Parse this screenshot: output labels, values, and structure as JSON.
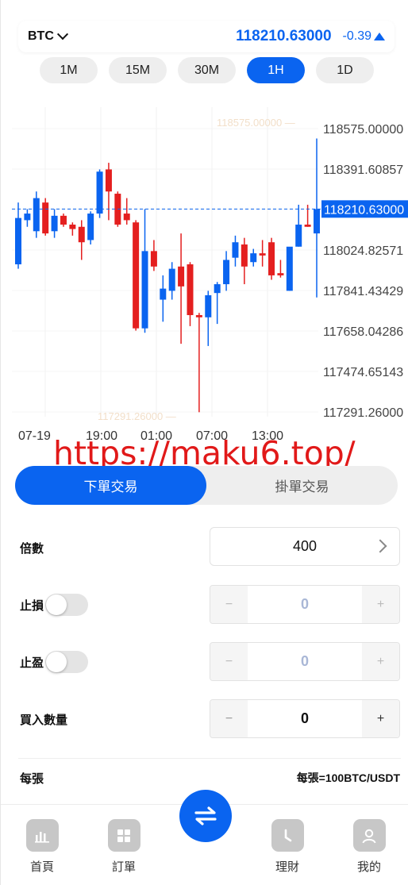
{
  "header": {
    "symbol": "BTC",
    "last_price": "118210.63000",
    "change": "-0.39"
  },
  "intervals": [
    {
      "label": "1M",
      "active": false
    },
    {
      "label": "15M",
      "active": false
    },
    {
      "label": "30M",
      "active": false
    },
    {
      "label": "1H",
      "active": true
    },
    {
      "label": "1D",
      "active": false
    }
  ],
  "colors": {
    "accent": "#0a64f0",
    "up": "#0a64f0",
    "down": "#e41f1f",
    "watermark": "#e11919"
  },
  "chart_data": {
    "type": "candlestick",
    "y_ticks": [
      "118575.00000",
      "118391.60857",
      "118210.63000",
      "118024.82571",
      "117841.43429",
      "117658.04286",
      "117474.65143",
      "117291.26000"
    ],
    "ylim": [
      117291.26,
      118575.0
    ],
    "x_ticks": [
      "07-19",
      "19:00",
      "01:00",
      "07:00",
      "13:00"
    ],
    "current_price_label": "118210.63000",
    "current_price": 118210.63,
    "max_label": "118575.00000",
    "min_label": "117291.26000",
    "candles": [
      {
        "o": 117960,
        "h": 118240,
        "l": 117940,
        "c": 118170
      },
      {
        "o": 118160,
        "h": 118210,
        "l": 118130,
        "c": 118190
      },
      {
        "o": 118110,
        "h": 118290,
        "l": 118080,
        "c": 118260
      },
      {
        "o": 118240,
        "h": 118260,
        "l": 118090,
        "c": 118100
      },
      {
        "o": 118110,
        "h": 118210,
        "l": 118080,
        "c": 118180
      },
      {
        "o": 118180,
        "h": 118190,
        "l": 118130,
        "c": 118140
      },
      {
        "o": 118140,
        "h": 118150,
        "l": 118090,
        "c": 118120
      },
      {
        "o": 118130,
        "h": 118160,
        "l": 117980,
        "c": 118060
      },
      {
        "o": 118070,
        "h": 118200,
        "l": 118050,
        "c": 118190
      },
      {
        "o": 118190,
        "h": 118390,
        "l": 118170,
        "c": 118380
      },
      {
        "o": 118390,
        "h": 118420,
        "l": 118160,
        "c": 118290
      },
      {
        "o": 118280,
        "h": 118290,
        "l": 118130,
        "c": 118140
      },
      {
        "o": 118190,
        "h": 118260,
        "l": 118140,
        "c": 118160
      },
      {
        "o": 118150,
        "h": 118160,
        "l": 117660,
        "c": 117670
      },
      {
        "o": 117670,
        "h": 118210,
        "l": 117650,
        "c": 118020
      },
      {
        "o": 118020,
        "h": 118070,
        "l": 117930,
        "c": 117950
      },
      {
        "o": 117800,
        "h": 117910,
        "l": 117700,
        "c": 117850
      },
      {
        "o": 117840,
        "h": 117970,
        "l": 117800,
        "c": 117940
      },
      {
        "o": 117950,
        "h": 118100,
        "l": 117600,
        "c": 117860
      },
      {
        "o": 117960,
        "h": 117970,
        "l": 117680,
        "c": 117730
      },
      {
        "o": 117730,
        "h": 117740,
        "l": 117290,
        "c": 117720
      },
      {
        "o": 117720,
        "h": 117840,
        "l": 117590,
        "c": 117820
      },
      {
        "o": 117830,
        "h": 117880,
        "l": 117690,
        "c": 117870
      },
      {
        "o": 117870,
        "h": 118020,
        "l": 117840,
        "c": 117980
      },
      {
        "o": 117990,
        "h": 118090,
        "l": 117950,
        "c": 118060
      },
      {
        "o": 118050,
        "h": 118080,
        "l": 117870,
        "c": 117950
      },
      {
        "o": 117970,
        "h": 118030,
        "l": 117950,
        "c": 118010
      },
      {
        "o": 118010,
        "h": 118070,
        "l": 117950,
        "c": 118000
      },
      {
        "o": 118060,
        "h": 118080,
        "l": 117890,
        "c": 117910
      },
      {
        "o": 117920,
        "h": 117980,
        "l": 117900,
        "c": 117910
      },
      {
        "o": 117840,
        "h": 118030,
        "l": 117840,
        "c": 118040
      },
      {
        "o": 118040,
        "h": 118230,
        "l": 118040,
        "c": 118140
      },
      {
        "o": 118140,
        "h": 118230,
        "l": 118130,
        "c": 118130
      },
      {
        "o": 118100,
        "h": 118530,
        "l": 117810,
        "c": 118210
      }
    ]
  },
  "order_tabs": {
    "market": "下單交易",
    "limit": "掛單交易"
  },
  "form": {
    "leverage_label": "倍數",
    "leverage_value": "400",
    "stop_loss_label": "止損",
    "stop_loss_value": "0",
    "take_profit_label": "止盈",
    "take_profit_value": "0",
    "quantity_label": "買入數量",
    "quantity_value": "0",
    "minus": "−",
    "plus": "+",
    "per_unit_label": "每張",
    "per_unit_value": "每張=100BTC/USDT"
  },
  "watermark": "https://maku6.top/",
  "nav": {
    "home": "首頁",
    "orders": "訂單",
    "finance": "理財",
    "mine": "我的"
  }
}
